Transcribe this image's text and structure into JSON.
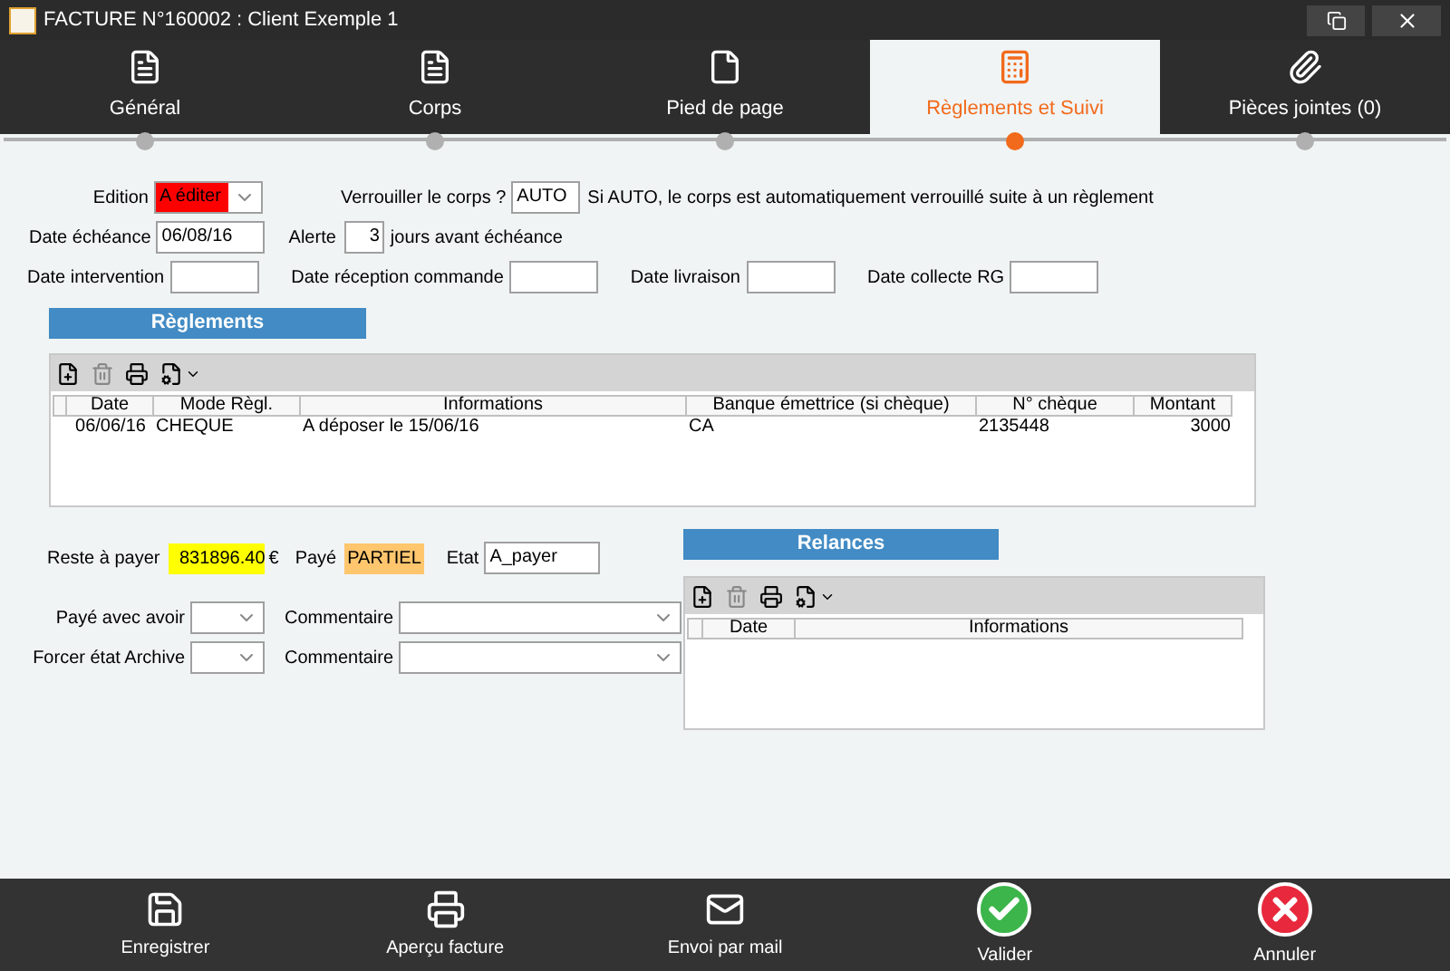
{
  "window": {
    "title": "FACTURE N°160002 : Client Exemple 1"
  },
  "tabs": [
    {
      "label": "Général",
      "selected": false
    },
    {
      "label": "Corps",
      "selected": false
    },
    {
      "label": "Pied de page",
      "selected": false
    },
    {
      "label": "Règlements et Suivi",
      "selected": true
    },
    {
      "label": "Pièces jointes (0)",
      "selected": false
    }
  ],
  "edition": {
    "label": "Edition",
    "value": "A éditer",
    "color": "#ff0000"
  },
  "lock": {
    "label": "Verrouiller le corps ?",
    "value": "AUTO",
    "note": "Si AUTO, le corps est automatiquement verrouillé suite à un règlement"
  },
  "due": {
    "label": "Date échéance",
    "value": "06/08/16"
  },
  "alert": {
    "label": "Alerte",
    "value": "3",
    "suffix": "jours avant échéance"
  },
  "dates": [
    {
      "label": "Date intervention"
    },
    {
      "label": "Date réception commande"
    },
    {
      "label": "Date livraison"
    },
    {
      "label": "Date collecte RG"
    }
  ],
  "payments": {
    "title": "Règlements",
    "columns": [
      "Date",
      "Mode Règl.",
      "Informations",
      "Banque émettrice (si chèque)",
      "N° chèque",
      "Montant"
    ],
    "rows": [
      [
        "06/06/16",
        "CHEQUE",
        "A déposer le 15/06/16",
        "CA",
        "2135448",
        "3000"
      ]
    ]
  },
  "balance": {
    "label": "Reste à payer",
    "value": "831896.40",
    "color": "#ffff00",
    "currency": "€"
  },
  "paid": {
    "label": "Payé",
    "value": "PARTIEL",
    "color": "#ffc66e"
  },
  "state": {
    "label": "Etat",
    "value": "A_payer"
  },
  "options": [
    {
      "label": "Payé avec avoir",
      "comment_label": "Commentaire"
    },
    {
      "label": "Forcer état Archive",
      "comment_label": "Commentaire"
    }
  ],
  "reminders": {
    "title": "Relances",
    "columns": [
      "Date",
      "Informations"
    ]
  },
  "actions": [
    {
      "label": "Enregistrer"
    },
    {
      "label": "Aperçu facture"
    },
    {
      "label": "Envoi par mail"
    },
    {
      "label": "Valider"
    },
    {
      "label": "Annuler"
    }
  ]
}
